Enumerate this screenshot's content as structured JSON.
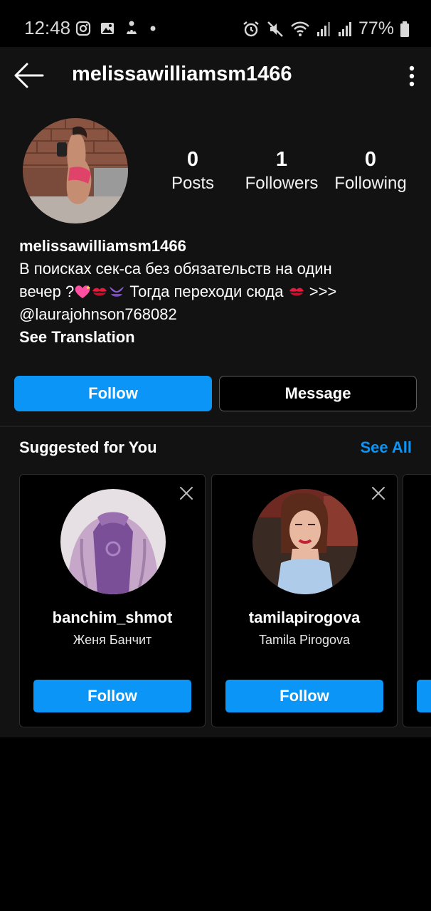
{
  "status_bar": {
    "time": "12:48",
    "battery": "77%",
    "left_icons": [
      "instagram-icon",
      "gallery-icon",
      "notification-icon",
      "dot-icon"
    ],
    "right_icons": [
      "alarm-icon",
      "mute-icon",
      "wifi-icon",
      "signal-icon",
      "signal-icon",
      "battery-icon"
    ]
  },
  "header": {
    "username": "melissawilliamsm1466"
  },
  "profile": {
    "posts_count": "0",
    "posts_label": "Posts",
    "followers_count": "1",
    "followers_label": "Followers",
    "following_count": "0",
    "following_label": "Following",
    "name": "melissawilliamsm1466",
    "bio_line1": "В поисках сек-са без обязательств на один",
    "bio_line2_a": "вечер ?",
    "bio_line2_b": " Тогда переходи сюда ",
    "bio_line2_c": " >>>",
    "bio_line3": "@laurajohnson768082",
    "see_translation": "See Translation"
  },
  "actions": {
    "follow": "Follow",
    "message": "Message"
  },
  "suggested": {
    "title": "Suggested for You",
    "see_all": "See All",
    "cards": [
      {
        "username": "banchim_shmot",
        "full_name": "Женя Банчит",
        "follow": "Follow"
      },
      {
        "username": "tamilapirogova",
        "full_name": "Tamila Pirogova",
        "follow": "Follow"
      }
    ]
  },
  "colors": {
    "accent": "#0a95f7",
    "background": "#121212",
    "card_bg": "#000000"
  }
}
